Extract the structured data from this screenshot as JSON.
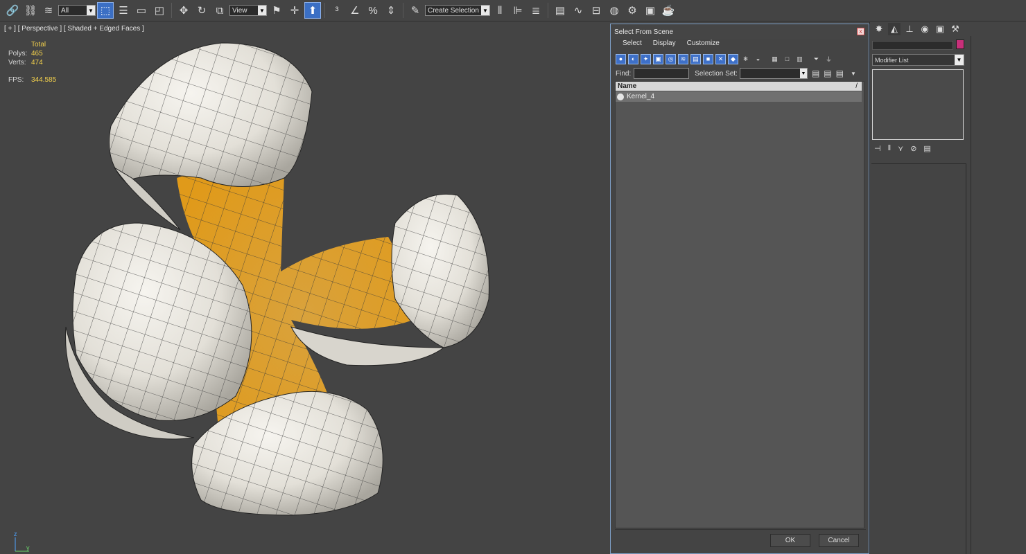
{
  "toolbar": {
    "selection_filter": "All",
    "reference_coord": "View",
    "named_selection": "Create Selection Se"
  },
  "viewport": {
    "label": "[ + ] [ Perspective ] [ Shaded + Edged Faces ]",
    "stats": {
      "header": "Total",
      "polys_label": "Polys:",
      "polys": "465",
      "verts_label": "Verts:",
      "verts": "474",
      "fps_label": "FPS:",
      "fps": "344.585"
    },
    "axis": {
      "z": "z",
      "y": "y"
    }
  },
  "dialog": {
    "title": "Select From Scene",
    "close": "x",
    "menu": [
      "Select",
      "Display",
      "Customize"
    ],
    "find_label": "Find:",
    "selection_set_label": "Selection Set:",
    "column_name": "Name",
    "sort_indicator": "/",
    "rows": [
      "Kernel_4"
    ],
    "ok": "OK",
    "cancel": "Cancel"
  },
  "command_panel": {
    "modifier_list": "Modifier List",
    "object_color": "#c8307a"
  },
  "colors": {
    "accent": "#3e70c8",
    "background": "#444444",
    "stats_yellow": "#f2d04c"
  }
}
